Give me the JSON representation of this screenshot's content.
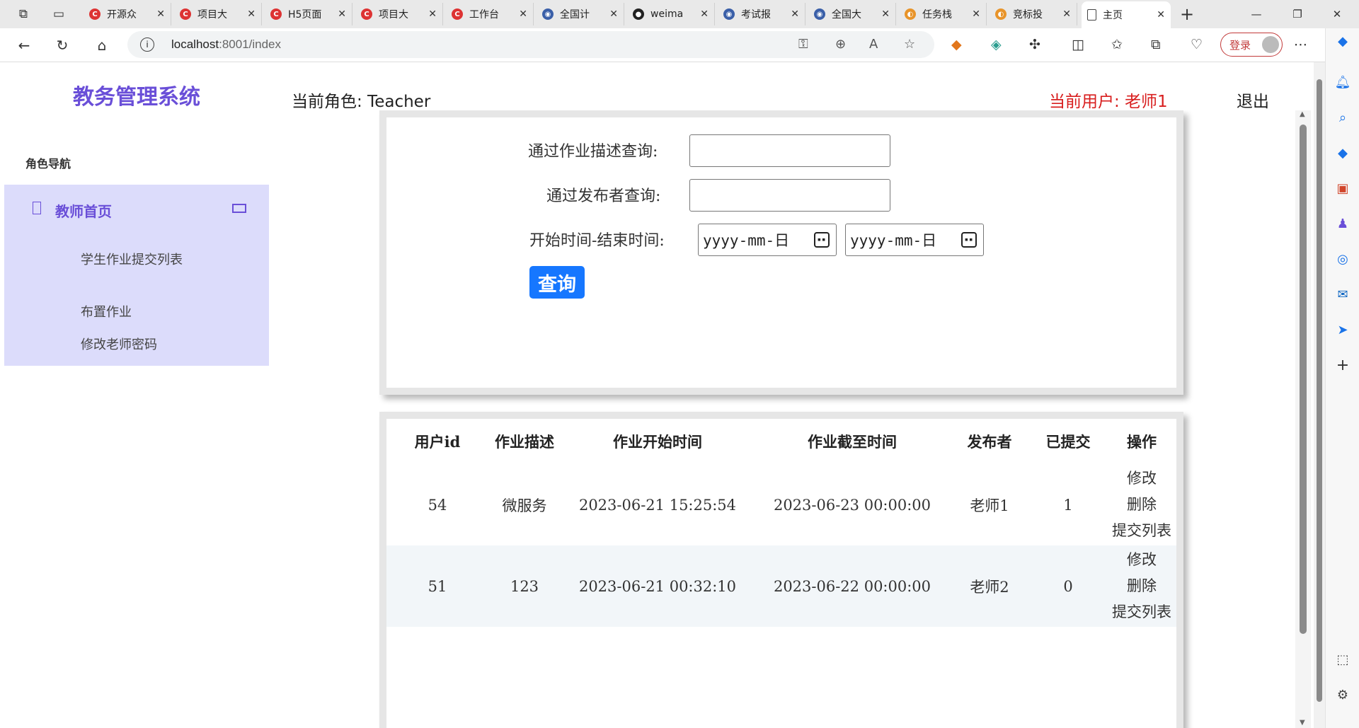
{
  "browser": {
    "tabs": [
      {
        "label": "开源众",
        "fav_color": "#d33",
        "fav_glyph": "C"
      },
      {
        "label": "项目大",
        "fav_color": "#d33",
        "fav_glyph": "C"
      },
      {
        "label": "H5页面",
        "fav_color": "#d33",
        "fav_glyph": "C"
      },
      {
        "label": "项目大",
        "fav_color": "#d33",
        "fav_glyph": "C"
      },
      {
        "label": "工作台",
        "fav_color": "#d33",
        "fav_glyph": "C"
      },
      {
        "label": "全国计",
        "fav_color": "#3a5fa8",
        "fav_glyph": "◉"
      },
      {
        "label": "weima",
        "fav_color": "#222",
        "fav_glyph": "●"
      },
      {
        "label": "考试报",
        "fav_color": "#3a5fa8",
        "fav_glyph": "◉"
      },
      {
        "label": "全国大",
        "fav_color": "#3a5fa8",
        "fav_glyph": "◉"
      },
      {
        "label": "任务栈",
        "fav_color": "#e8942a",
        "fav_glyph": "◐"
      },
      {
        "label": "竞标投",
        "fav_color": "#e8942a",
        "fav_glyph": "◐"
      },
      {
        "label": "主页",
        "fav_color": "#666",
        "fav_glyph": "▯"
      }
    ],
    "url_host": "localhost",
    "url_rest": ":8001/index",
    "login_label": "登录"
  },
  "app": {
    "title": "教务管理系统",
    "nav_heading": "角色导航",
    "nav_group_title": "教师首页",
    "nav_items": [
      "学生作业提交列表",
      "布置作业",
      "修改老师密码"
    ],
    "role_text": "当前角色: Teacher",
    "user_text": "当前用户: 老师1",
    "logout_label": "退出",
    "colors": {
      "accent": "#6a4fd8",
      "nav_bg": "#dcdcfb",
      "user": "#d81e1e",
      "primary_btn": "#1677ff"
    }
  },
  "search": {
    "desc_label": "通过作业描述查询:",
    "desc_value": "",
    "publisher_label": "通过发布者查询:",
    "publisher_value": "",
    "time_label": "开始时间-结束时间:",
    "start_placeholder": "yyyy-mm-日",
    "end_placeholder": "yyyy-mm-日",
    "query_label": "查询"
  },
  "table": {
    "headers": [
      "用户id",
      "作业描述",
      "作业开始时间",
      "作业截至时间",
      "发布者",
      "已提交",
      "操作"
    ],
    "rows": [
      {
        "id": "54",
        "desc": "微服务",
        "start": "2023-06-21 15:25:54",
        "end": "2023-06-23 00:00:00",
        "publisher": "老师1",
        "submitted": "1"
      },
      {
        "id": "51",
        "desc": "123",
        "start": "2023-06-21 00:32:10",
        "end": "2023-06-22 00:00:00",
        "publisher": "老师2",
        "submitted": "0"
      }
    ],
    "ops": {
      "edit": "修改",
      "delete": "删除",
      "list": "提交列表"
    }
  }
}
